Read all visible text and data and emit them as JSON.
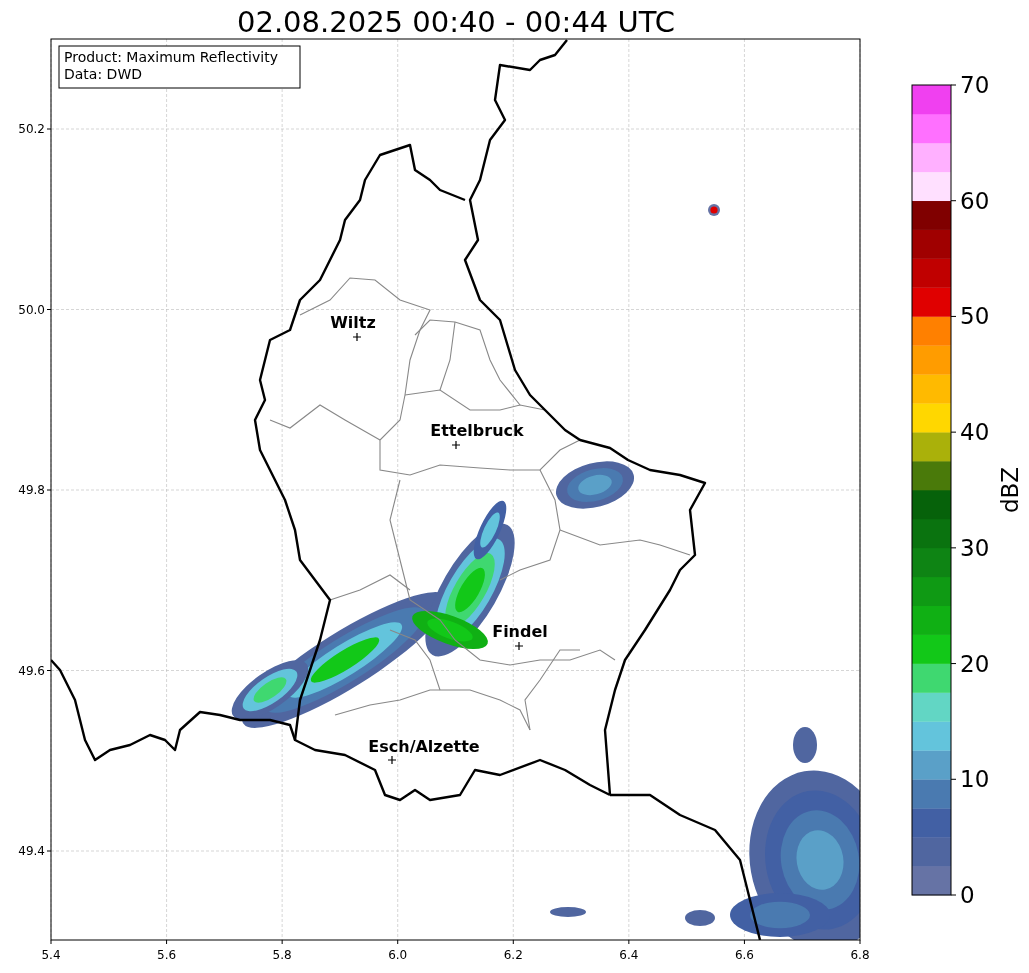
{
  "title": "02.08.2025 00:40 - 00:44 UTC",
  "info_box": {
    "lines": [
      "Product: Maximum Reflectivity",
      "Data: DWD"
    ]
  },
  "x_axis": {
    "ticks": [
      "5.4",
      "5.6",
      "5.8",
      "6.0",
      "6.2",
      "6.4",
      "6.6",
      "6.8"
    ]
  },
  "y_axis": {
    "ticks": [
      "50.2",
      "50.0",
      "49.8",
      "49.6",
      "49.4"
    ]
  },
  "cities": [
    {
      "name": "Wiltz"
    },
    {
      "name": "Ettelbruck"
    },
    {
      "name": "Findel"
    },
    {
      "name": "Esch/Alzette"
    }
  ],
  "colorbar": {
    "label": "dBZ",
    "ticks": [
      "70",
      "60",
      "50",
      "40",
      "30",
      "20",
      "10",
      "0"
    ],
    "steps": [
      {
        "color": "#6673a5"
      },
      {
        "color": "#5066a0"
      },
      {
        "color": "#4260a4"
      },
      {
        "color": "#4a7ab0"
      },
      {
        "color": "#5aa0c8"
      },
      {
        "color": "#63c4dc"
      },
      {
        "color": "#62d6c4"
      },
      {
        "color": "#3fd870"
      },
      {
        "color": "#12c818"
      },
      {
        "color": "#10b014"
      },
      {
        "color": "#0f9a14"
      },
      {
        "color": "#0e8414"
      },
      {
        "color": "#0a730f"
      },
      {
        "color": "#06620a"
      },
      {
        "color": "#4a7a0a"
      },
      {
        "color": "#aab10a"
      },
      {
        "color": "#ffd700"
      },
      {
        "color": "#ffba00"
      },
      {
        "color": "#ff9c00"
      },
      {
        "color": "#ff8000"
      },
      {
        "color": "#e00000"
      },
      {
        "color": "#c00000"
      },
      {
        "color": "#a00000"
      },
      {
        "color": "#800000"
      },
      {
        "color": "#ffe0ff"
      },
      {
        "color": "#ffb0ff"
      },
      {
        "color": "#ff70ff"
      },
      {
        "color": "#f040f0"
      }
    ]
  }
}
